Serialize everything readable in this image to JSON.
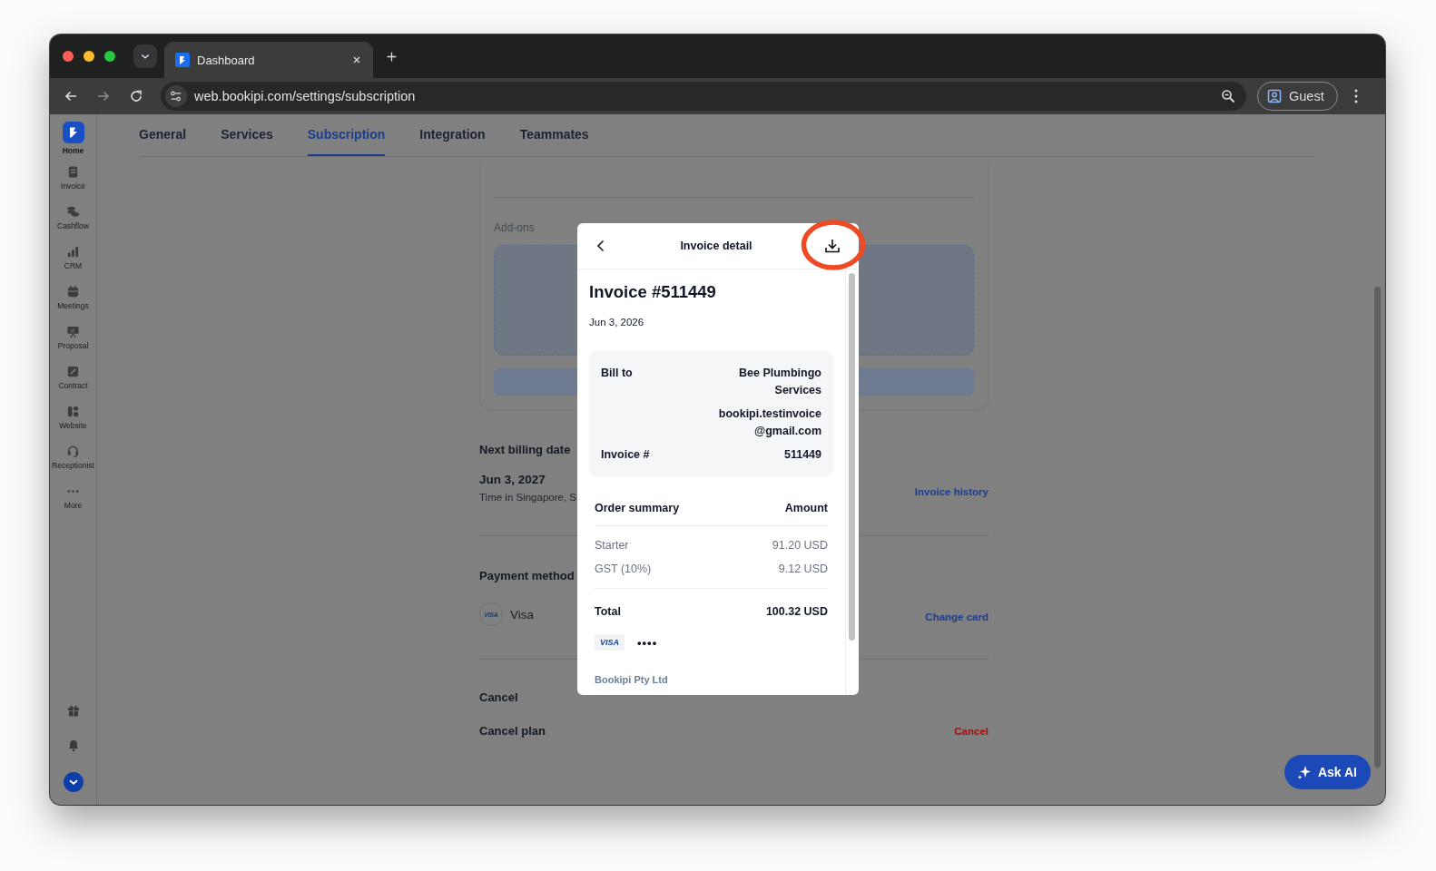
{
  "browser": {
    "tab_title": "Dashboard",
    "url": "web.bookipi.com/settings/subscription",
    "profile": "Guest"
  },
  "sidebar": {
    "items": [
      {
        "label": "Home",
        "selected": true
      },
      {
        "label": "Invoice",
        "selected": false
      },
      {
        "label": "Cashflow",
        "selected": false
      },
      {
        "label": "CRM",
        "selected": false
      },
      {
        "label": "Meetings",
        "selected": false
      },
      {
        "label": "Proposal",
        "selected": false
      },
      {
        "label": "Contract",
        "selected": false
      },
      {
        "label": "Website",
        "selected": false
      },
      {
        "label": "Receptionist",
        "selected": false
      },
      {
        "label": "More",
        "selected": false
      }
    ]
  },
  "tabs": [
    {
      "label": "General",
      "selected": false
    },
    {
      "label": "Services",
      "selected": false
    },
    {
      "label": "Subscription",
      "selected": true
    },
    {
      "label": "Integration",
      "selected": false
    },
    {
      "label": "Teammates",
      "selected": false
    }
  ],
  "addons": {
    "label": "Add-ons"
  },
  "billing": {
    "title": "Next billing date",
    "date": "Jun 3, 2027",
    "note": "Time in Singapore, S",
    "link": "Invoice history"
  },
  "payment": {
    "title": "Payment method",
    "card_brand": "VISA",
    "card": "Visa",
    "link": "Change card"
  },
  "cancel": {
    "title": "Cancel",
    "label": "Cancel plan",
    "link": "Cancel"
  },
  "ask_ai": "Ask AI",
  "modal": {
    "title": "Invoice detail",
    "invoice_title": "Invoice #511449",
    "date": "Jun 3, 2026",
    "details": [
      {
        "label": "Bill to",
        "lines": [
          "Bee Plumbingo",
          "Services"
        ]
      },
      {
        "lines": [
          "bookipi.testinvoice",
          "@gmail.com"
        ]
      },
      {
        "label": "Invoice #",
        "lines": [
          "511449"
        ]
      }
    ],
    "summary_header": {
      "label": "Order summary",
      "amount": "Amount"
    },
    "items": [
      {
        "label": "Starter",
        "amount": "91.20 USD"
      },
      {
        "label": "GST (10%)",
        "amount": "9.12 USD"
      }
    ],
    "total": {
      "label": "Total",
      "amount": "100.32 USD"
    },
    "card_brand": "VISA",
    "card_digits": "••••",
    "footer": "Bookipi Pty Ltd"
  }
}
